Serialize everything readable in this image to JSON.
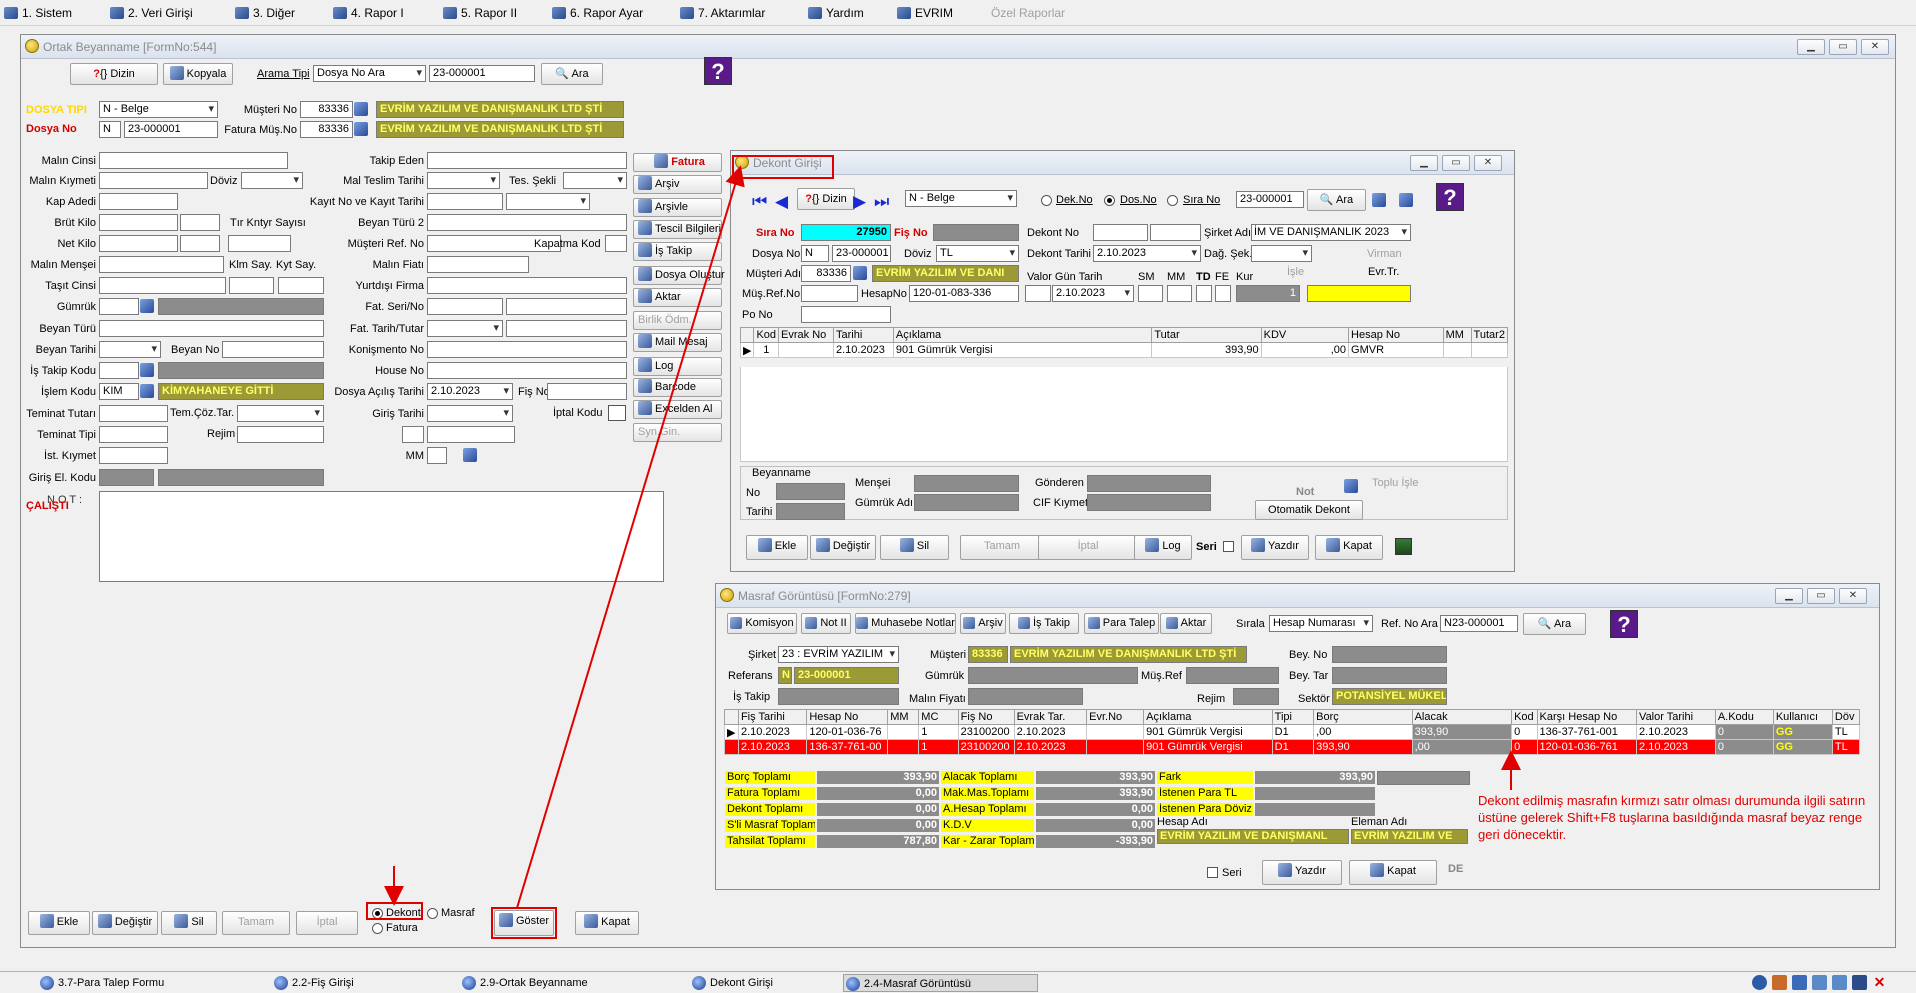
{
  "menu": [
    "1. Sistem",
    "2. Veri Girişi",
    "3. Diğer",
    "4. Rapor I",
    "5. Rapor II",
    "6. Rapor Ayar",
    "7. Aktarımlar",
    "Yardım",
    "EVRIM",
    "Özel Raporlar"
  ],
  "main": {
    "title": "Ortak Beyanname [FormNo:544]",
    "toolbar": {
      "dizin": "Dizin",
      "kopyala": "Kopyala",
      "arama_tipi_lbl": "Arama Tipi",
      "arama_tipi": "Dosya No Ara",
      "arama_val": "23-000001",
      "ara": "Ara"
    },
    "dosya_tipi_lbl": "DOSYA TIPI",
    "dosya_tipi": "N - Belge",
    "dosya_no_lbl": "Dosya No",
    "dosya_no_prefix": "N",
    "dosya_no": "23-000001",
    "musteri_no_lbl": "Müşteri No",
    "musteri_no": "83336",
    "musteri_adi": "EVRİM YAZILIM VE DANIŞMANLIK LTD ŞTİ",
    "fatura_mus_lbl": "Fatura Müş.No",
    "fatura_mus": "83336",
    "fatura_mus_adi": "EVRİM YAZILIM VE DANIŞMANLIK LTD ŞTİ",
    "left_labels": [
      "Malın Cinsi",
      "Malın Kıymeti",
      "Kap Adedi",
      "Brüt Kilo",
      "Net Kilo",
      "Malın Menşei",
      "Taşıt Cinsi",
      "Gümrük",
      "Beyan Türü",
      "Beyan Tarihi",
      "İş Takip Kodu",
      "İşlem Kodu",
      "Teminat Tutarı",
      "Teminat Tipi",
      "İst. Kıymet",
      "Giriş El. Kodu"
    ],
    "doviz_lbl": "Döviz",
    "tir_lbl": "Tır Kntyr Sayısı",
    "klm_lbl": "Klm Say.",
    "kyt_lbl": "Kyt Say.",
    "beyan_no_lbl": "Beyan No",
    "tem_coz_lbl": "Tem.Çöz.Tar.",
    "rejim_lbl": "Rejim",
    "islem_kodu": "KIM",
    "islem_adi": "KİMYAHANEYE GİTTİ",
    "mid_labels": [
      "Takip Eden",
      "Mal Teslim Tarihi",
      "Kayıt  No  ve Kayıt Tarihi",
      "Beyan Türü 2",
      "Müşteri  Ref. No",
      "Malın Fiatı",
      "Yurtdışı Firma",
      "Fat. Seri/No",
      "Fat. Tarih/Tutar",
      "Konişmento No",
      "House No",
      "Dosya Açılış Tarihi",
      "Giriş Tarihi",
      "",
      "MM"
    ],
    "tes_sekli_lbl": "Tes. Şekli",
    "kapatma_lbl": "Kapatma Kod",
    "fis_no_lbl": "Fiş No",
    "iptal_kodu_lbl": "İptal Kodu",
    "acilis_tarihi": "2.10.2023",
    "not_lbl": "N O T :",
    "calisti": "ÇALIŞTI",
    "side_buttons": [
      "Fatura",
      "Arşiv",
      "Arşivle",
      "Tescil Bilgileri",
      "İş Takip",
      "Dosya Oluştur",
      "Aktar",
      "Birlik Ödm.",
      "Mail Mesaj",
      "Log",
      "Barcode",
      "Excelden Al",
      "Syn.Gin."
    ],
    "bottom": {
      "ekle": "Ekle",
      "degistir": "Değiştir",
      "sil": "Sil",
      "tamam": "Tamam",
      "iptal": "İptal",
      "dekont": "Dekont",
      "masraf": "Masraf",
      "fatura": "Fatura",
      "goster": "Göster",
      "kapat": "Kapat"
    }
  },
  "dekont": {
    "title": "Dekont Girişi",
    "dizin": "Dizin",
    "belge": "N - Belge",
    "radio": [
      "Dek.No",
      "Dos.No",
      "Sıra No"
    ],
    "search": "23-000001",
    "ara": "Ara",
    "sira_no_lbl": "Sıra No",
    "sira_no": "27950",
    "fis_no_lbl": "Fiş No",
    "dekont_no_lbl": "Dekont No",
    "sirket_adi_lbl": "Şirket Adı",
    "sirket_adi": "İM VE DANIŞMANLIK 2023",
    "dosya_no_lbl": "Dosya No",
    "dosya_prefix": "N",
    "dosya_no": "23-000001",
    "doviz_lbl": "Döviz",
    "doviz": "TL",
    "dekont_tarihi_lbl": "Dekont Tarihi",
    "dekont_tarihi": "2.10.2023",
    "dag_sek_lbl": "Dağ. Şek.",
    "virman": "Virman",
    "musteri_adi_lbl": "Müşteri Adı",
    "musteri_no": "83336",
    "musteri_adi": "EVRİM YAZILIM VE DANI",
    "valor_lbl": "Valor Gün Tarih",
    "sm": "SM",
    "mm": "MM",
    "td": "TD",
    "fe": "FE",
    "kur": "Kur",
    "isle": "İşle",
    "evr": "Evr.Tr.",
    "mus_ref_lbl": "Müş.Ref.No",
    "hesap_no_lbl": "HesapNo",
    "hesap_no": "120-01-083-336",
    "valor_tarih": "2.10.2023",
    "kur_val": "1",
    "po_no_lbl": "Po No",
    "grid_headers": [
      "Kod",
      "Evrak No",
      "Tarihi",
      "Açıklama",
      "Tutar",
      "KDV",
      "Hesap No",
      "MM",
      "Tutar2"
    ],
    "grid_rows": [
      {
        "kod": "1",
        "evrak": "",
        "tarih": "2.10.2023",
        "aciklama": "901 Gümrük Vergisi",
        "tutar": "393,90",
        "kdv": ",00",
        "hesap": "GMVR",
        "mm": "",
        "tutar2": ""
      }
    ],
    "beyanname_lbl": "Beyanname",
    "no_lbl": "No",
    "tarihi_lbl": "Tarihi",
    "mensei_lbl": "Menşei",
    "gumruk_adi_lbl": "Gümrük Adı",
    "gonderen_lbl": "Gönderen",
    "cif_lbl": "CIF Kıymeti",
    "not_lbl": "Not",
    "toplu_isle": "Toplu İşle",
    "otomatik": "Otomatik Dekont",
    "bottom": {
      "ekle": "Ekle",
      "degistir": "Değiştir",
      "sil": "Sil",
      "tamam": "Tamam",
      "iptal": "İptal",
      "log": "Log",
      "seri": "Seri",
      "yazdir": "Yazdır",
      "kapat": "Kapat"
    }
  },
  "masraf": {
    "title": "Masraf Görüntüsü [FormNo:279]",
    "toolbar": [
      "Komisyon",
      "Not II",
      "Muhasebe Notlar",
      "Arşiv",
      "İş Takip",
      "Para Talep",
      "Aktar"
    ],
    "sirala_lbl": "Sırala",
    "sirala": "Hesap Numarası",
    "ref_ara_lbl": "Ref. No Ara",
    "ref_ara": "N23-000001",
    "ara": "Ara",
    "sirket_lbl": "Şirket",
    "sirket": "23 : EVRİM YAZILIM",
    "musteri_lbl": "Müşteri",
    "musteri_no": "83336",
    "musteri_adi": "EVRİM YAZILIM VE DANIŞMANLIK LTD ŞTİ",
    "bey_no_lbl": "Bey. No",
    "referans_lbl": "Referans",
    "ref_prefix": "N",
    "referans": "23-000001",
    "gumruk_lbl": "Gümrük",
    "mus_ref_lbl": "Müş.Ref",
    "bey_tar_lbl": "Bey. Tar",
    "is_takip_lbl": "İş Takip",
    "malin_fiyati_lbl": "Malın Fiyatı",
    "rejim_lbl": "Rejim",
    "sektor_lbl": "Sektör",
    "sektor": "POTANSİYEL MÜKELL",
    "grid_headers": [
      "Fiş Tarihi",
      "Hesap No",
      "MM",
      "MC",
      "Fiş No",
      "Evrak Tar.",
      "Evr.No",
      "Açıklama",
      "Tipi",
      "Borç",
      "Alacak",
      "Kod",
      "Karşı Hesap No",
      "Valor Tarihi",
      "A.Kodu",
      "Kullanıcı",
      "Döv"
    ],
    "grid_rows": [
      {
        "fis_tarihi": "2.10.2023",
        "hesap": "120-01-036-76",
        "mm": "",
        "mc": "1",
        "fis_no": "23100200",
        "evrak_tar": "2.10.2023",
        "evr_no": "",
        "aciklama": "901 Gümrük Vergisi",
        "tipi": "D1",
        "borc": ",00",
        "alacak": "393,90",
        "kod": "0",
        "karsi": "136-37-761-001",
        "valor": "2.10.2023",
        "akodu": "0",
        "kullanici": "GG",
        "dov": "TL"
      },
      {
        "fis_tarihi": "2.10.2023",
        "hesap": "136-37-761-00",
        "mm": "",
        "mc": "1",
        "fis_no": "23100200",
        "evrak_tar": "2.10.2023",
        "evr_no": "",
        "aciklama": "901 Gümrük Vergisi",
        "tipi": "D1",
        "borc": "393,90",
        "alacak": ",00",
        "kod": "0",
        "karsi": "120-01-036-761",
        "valor": "2.10.2023",
        "akodu": "0",
        "kullanici": "GG",
        "dov": "TL"
      }
    ],
    "totals_left": [
      [
        "Borç Toplamı",
        "393,90"
      ],
      [
        "Fatura Toplamı",
        "0,00"
      ],
      [
        "Dekont Toplamı",
        "0,00"
      ],
      [
        "S'li Masraf Toplamı",
        "0,00"
      ],
      [
        "Tahsilat Toplamı",
        "787,80"
      ]
    ],
    "totals_mid": [
      [
        "Alacak Toplamı",
        "393,90"
      ],
      [
        "Mak.Mas.Toplamı",
        "393,90"
      ],
      [
        "A.Hesap Toplamı",
        "0,00"
      ],
      [
        "K.D.V",
        "0,00"
      ],
      [
        "Kar - Zarar Toplamı",
        "-393,90"
      ]
    ],
    "totals_right": [
      [
        "Fark",
        "393,90"
      ],
      [
        "İstenen Para TL",
        ""
      ],
      [
        "İstenen Para Döviz",
        ""
      ]
    ],
    "hesap_adi_lbl": "Hesap Adı",
    "eleman_adi_lbl": "Eleman Adı",
    "hesap_adi": "EVRİM YAZILIM VE DANIŞMANL",
    "eleman_adi": "EVRİM YAZILIM VE",
    "seri": "Seri",
    "yazdir": "Yazdır",
    "kapat": "Kapat",
    "de": "DE"
  },
  "annotation": "Dekont edilmiş masrafın kırmızı satır olması durumunda ilgili satırın üstüne gelerek Shift+F8 tuşlarına basıldığında masraf beyaz renge geri dönecektir.",
  "taskbar": [
    "3.7-Para Talep Formu",
    "2.2-Fiş Girişi",
    "2.9-Ortak Beyanname",
    "Dekont Girişi",
    "2.4-Masraf Görüntüsü"
  ],
  "colors": {
    "annotation": "#e00000",
    "highlight_row": "#ff0000",
    "label_yellow": "#ffff00",
    "value_gray": "#8c8c8c"
  }
}
